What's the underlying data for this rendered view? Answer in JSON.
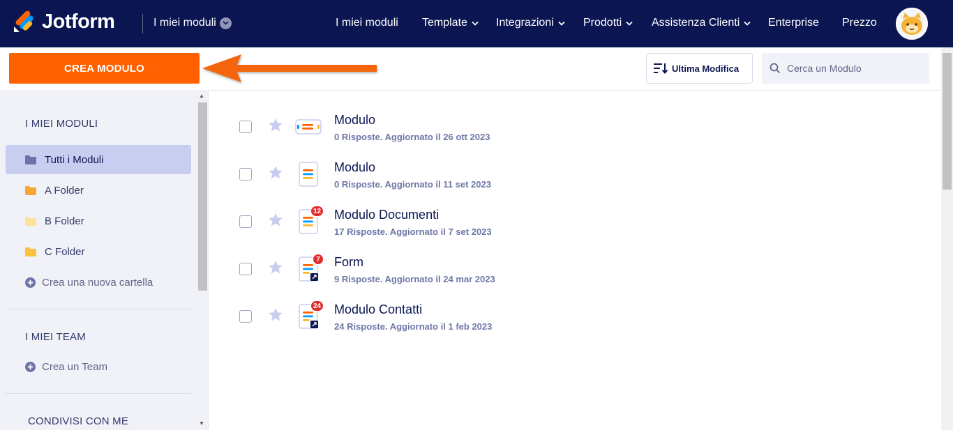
{
  "colors": {
    "nav_bg": "#0a1551",
    "accent": "#ff6100",
    "badge": "#e22d2d"
  },
  "topbar": {
    "logo_text": "Jotform",
    "workspace": "I miei moduli",
    "nav": [
      {
        "label": "I miei moduli",
        "dropdown": false
      },
      {
        "label": "Template",
        "dropdown": true
      },
      {
        "label": "Integrazioni",
        "dropdown": true
      },
      {
        "label": "Prodotti",
        "dropdown": true
      },
      {
        "label": "Assistenza Clienti",
        "dropdown": true
      },
      {
        "label": "Enterprise",
        "dropdown": false
      },
      {
        "label": "Prezzo",
        "dropdown": false
      }
    ]
  },
  "toolbar": {
    "create_label": "CREA MODULO",
    "sort_label": "Ultima Modifica",
    "search_placeholder": "Cerca un Modulo"
  },
  "sidebar": {
    "my_forms_title": "I MIEI MODULI",
    "items": [
      {
        "label": "Tutti i Moduli",
        "icon": "folder-icon",
        "active": true
      },
      {
        "label": "A Folder",
        "icon": "folder-icon"
      },
      {
        "label": "B Folder",
        "icon": "folder-icon"
      },
      {
        "label": "C Folder",
        "icon": "folder-icon"
      }
    ],
    "new_folder_label": "Crea una nuova cartella",
    "teams_title": "I MIEI TEAM",
    "new_team_label": "Crea un Team",
    "shared_title": "CONDIVISI CON ME"
  },
  "forms": [
    {
      "name": "Modulo",
      "meta": "0 Risposte. Aggiornato il 26 ott 2023",
      "icon": "card-form-icon",
      "badge": ""
    },
    {
      "name": "Modulo",
      "meta": "0 Risposte. Aggiornato il 11 set 2023",
      "icon": "classic-form-icon",
      "badge": ""
    },
    {
      "name": "Modulo Documenti",
      "meta": "17 Risposte. Aggiornato il 7 set 2023",
      "icon": "classic-form-icon",
      "badge": "12"
    },
    {
      "name": "Form",
      "meta": "9 Risposte. Aggiornato il 24 mar 2023",
      "icon": "classic-form-icon",
      "badge": "7"
    },
    {
      "name": "Modulo Contatti",
      "meta": "24 Risposte. Aggiornato il 1 feb 2023",
      "icon": "classic-form-icon",
      "badge": "24"
    }
  ]
}
